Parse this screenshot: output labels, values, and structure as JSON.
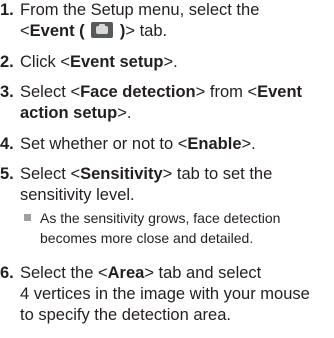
{
  "steps": [
    {
      "number": "1.",
      "line1": "From the Setup menu, select the",
      "pre": "<",
      "bold": "Event (",
      "icon": "camera-icon",
      "bold_after": ")",
      "post": "> tab."
    },
    {
      "number": "2.",
      "pre": "Click <",
      "bold": "Event setup",
      "post": ">."
    },
    {
      "number": "3.",
      "pre": "Select <",
      "bold": "Face detection",
      "mid": "> from <",
      "bold2_line1": "Event",
      "bold2_line2": "action setup",
      "post": ">."
    },
    {
      "number": "4.",
      "pre": "Set whether or not to <",
      "bold": "Enable",
      "post": ">."
    },
    {
      "number": "5.",
      "pre": "Select <",
      "bold": "Sensitivity",
      "post_line1": "> tab to set the",
      "line2": "sensitivity level.",
      "note_line1": "As the sensitivity grows, face detection",
      "note_line2": "becomes more close and detailed."
    },
    {
      "number": "6.",
      "pre": "Select the <",
      "bold": "Area",
      "post_line1": "> tab and select",
      "line2": "4 vertices in the image with your mouse",
      "line3": "to specify the detection area."
    }
  ]
}
